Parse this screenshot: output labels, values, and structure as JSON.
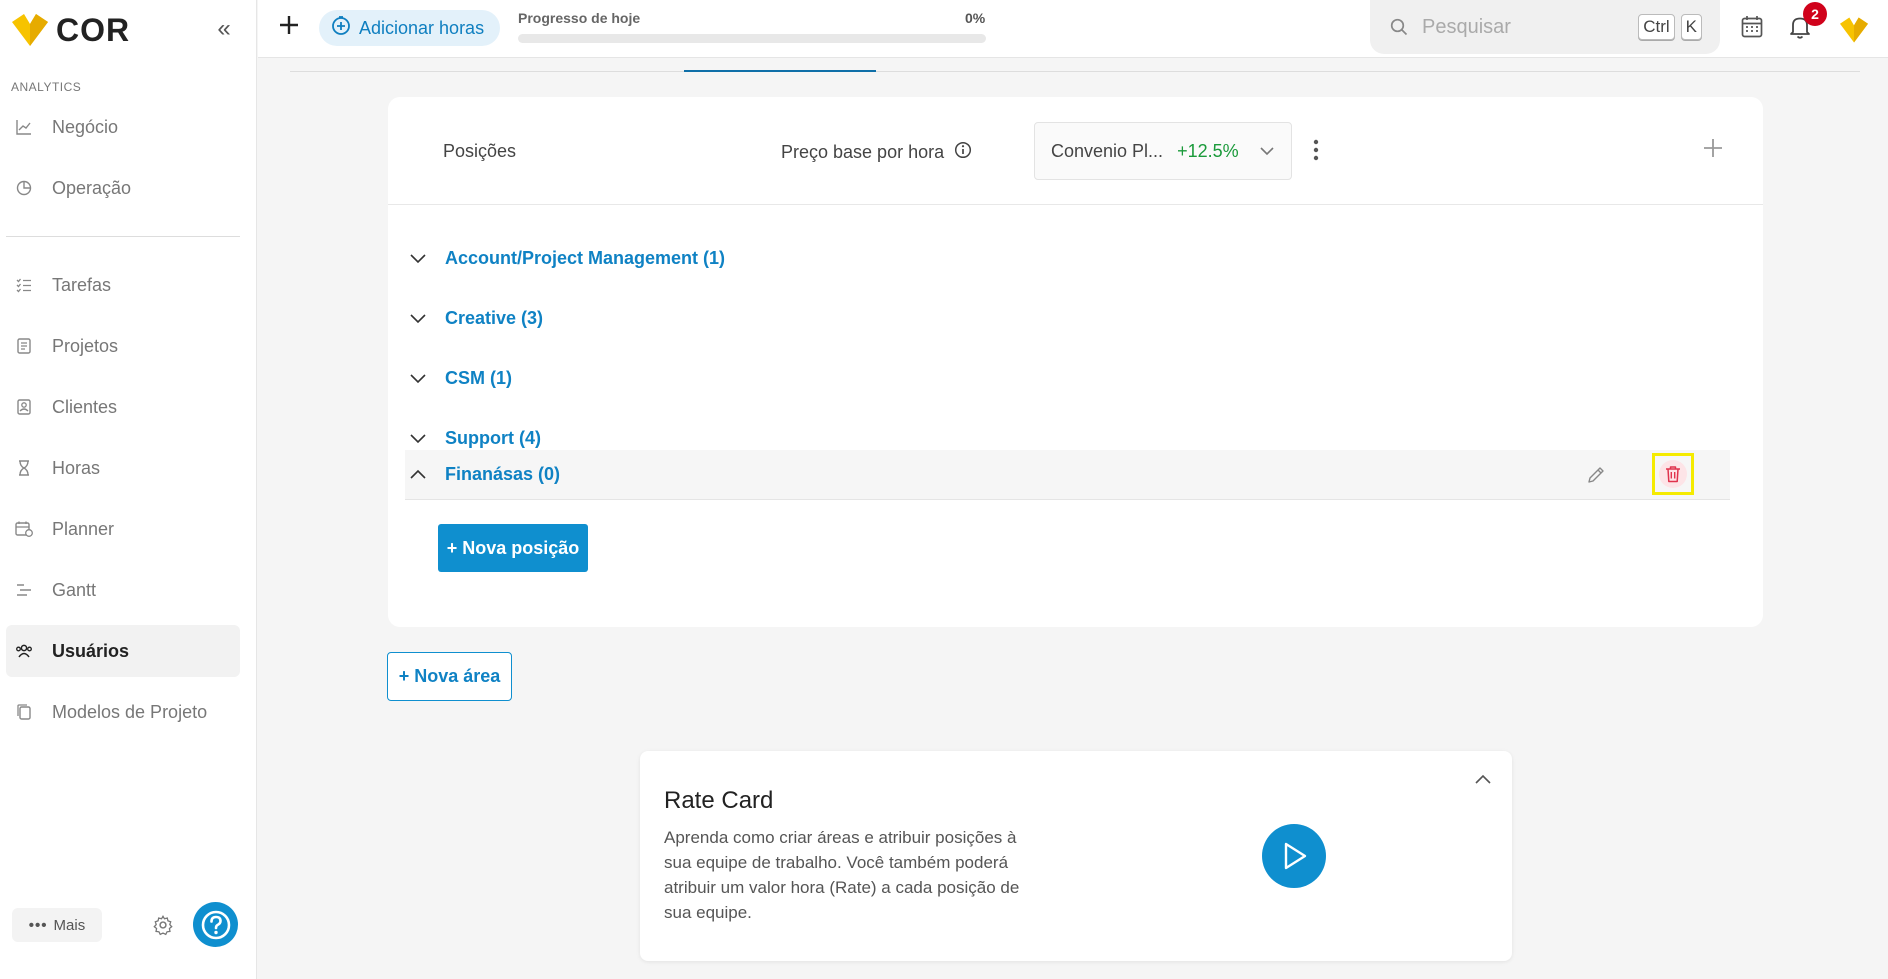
{
  "sidebar": {
    "logo_text": "COR",
    "section_label": "ANALYTICS",
    "analytics_items": [
      {
        "label": "Negócio",
        "icon": "chart-line-icon"
      },
      {
        "label": "Operação",
        "icon": "pie-chart-icon"
      }
    ],
    "items": [
      {
        "label": "Tarefas",
        "icon": "task-list-icon"
      },
      {
        "label": "Projetos",
        "icon": "document-icon"
      },
      {
        "label": "Clientes",
        "icon": "contact-card-icon"
      },
      {
        "label": "Horas",
        "icon": "hourglass-icon"
      },
      {
        "label": "Planner",
        "icon": "calendar-clock-icon"
      },
      {
        "label": "Gantt",
        "icon": "gantt-icon"
      },
      {
        "label": "Usuários",
        "icon": "users-icon",
        "active": true
      },
      {
        "label": "Modelos de Projeto",
        "icon": "copy-icon"
      }
    ],
    "more_label": "Mais"
  },
  "topbar": {
    "add_hours_label": "Adicionar horas",
    "progress_label": "Progresso de hoje",
    "progress_value": "0%",
    "progress_fraction": 0,
    "search_placeholder": "Pesquisar",
    "shortcut_key1": "Ctrl",
    "shortcut_key2": "K",
    "notification_count": "2"
  },
  "rate_table": {
    "header_positions": "Posições",
    "header_price": "Preço base por hora",
    "rate_select_value": "Convenio Pl...",
    "rate_select_pct": "+12.5%",
    "areas": [
      {
        "label": "Account/Project Management (1)",
        "expanded": false
      },
      {
        "label": "Creative (3)",
        "expanded": false
      },
      {
        "label": "CSM (1)",
        "expanded": false
      },
      {
        "label": "Support (4)",
        "expanded": false
      },
      {
        "label": "Finanásas (0)",
        "expanded": true
      }
    ],
    "new_position_label": "+ Nova posição"
  },
  "new_area_label": "+ Nova área",
  "rate_card_info": {
    "title": "Rate Card",
    "text": "Aprenda como criar áreas e atribuir posições à sua equipe de trabalho. Você também poderá atribuir um valor hora (Rate) a cada posição de sua equipe."
  },
  "colors": {
    "accent": "#0f8fcf",
    "link": "#0f82c4",
    "brand_yellow": "#f7c300",
    "positive": "#1a9a3a",
    "badge": "#d0021b",
    "highlight": "#f5eb00"
  }
}
